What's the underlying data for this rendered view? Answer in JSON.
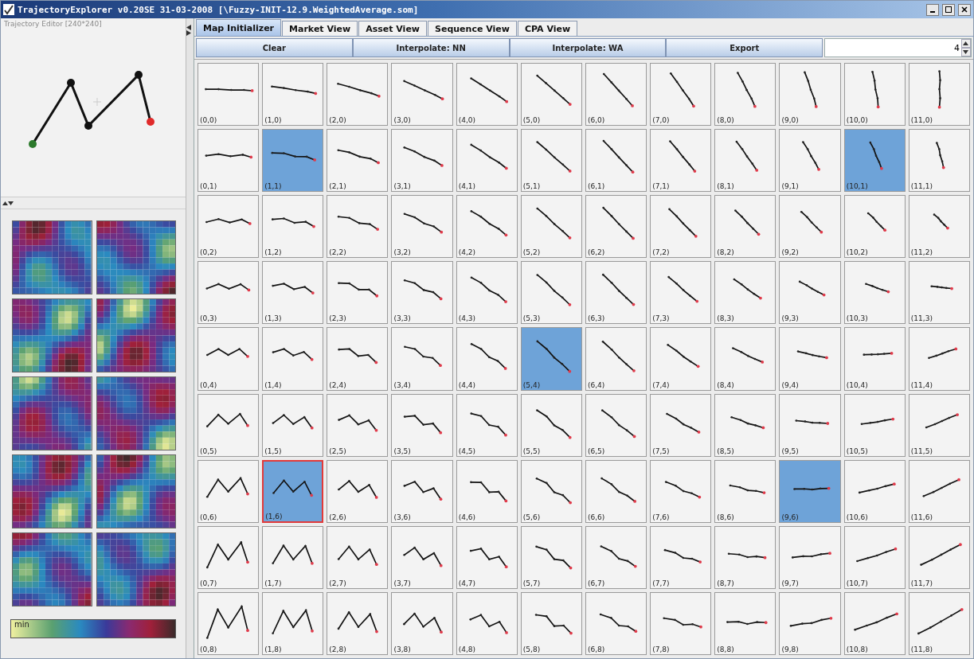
{
  "window": {
    "title": "TrajectoryExplorer v0.20SE 31-03-2008 [\\Fuzzy-INIT-12.9.WeightedAverage.som]"
  },
  "editor": {
    "title": "Trajectory Editor [240*240]"
  },
  "legend": {
    "label": "min"
  },
  "tabs": [
    {
      "label": "Map Initializer",
      "selected": true
    },
    {
      "label": "Market View",
      "selected": false
    },
    {
      "label": "Asset View",
      "selected": false
    },
    {
      "label": "Sequence View",
      "selected": false
    },
    {
      "label": "CPA View",
      "selected": false
    }
  ],
  "toolbar": {
    "buttons": [
      "Clear",
      "Interpolate: NN",
      "Interpolate: WA",
      "Export"
    ],
    "spinner": {
      "value": "4"
    }
  },
  "grid": {
    "rows": [
      [
        {
          "label": "(0,0)",
          "selected": false,
          "focused": false
        },
        {
          "label": "(1,0)",
          "selected": false,
          "focused": false
        },
        {
          "label": "(2,0)",
          "selected": false,
          "focused": false
        },
        {
          "label": "(3,0)",
          "selected": false,
          "focused": false
        },
        {
          "label": "(4,0)",
          "selected": false,
          "focused": false
        },
        {
          "label": "(5,0)",
          "selected": false,
          "focused": false
        },
        {
          "label": "(6,0)",
          "selected": false,
          "focused": false
        },
        {
          "label": "(7,0)",
          "selected": false,
          "focused": false
        },
        {
          "label": "(8,0)",
          "selected": false,
          "focused": false
        },
        {
          "label": "(9,0)",
          "selected": false,
          "focused": false
        },
        {
          "label": "(10,0)",
          "selected": false,
          "focused": false
        },
        {
          "label": "(11,0)",
          "selected": false,
          "focused": false
        }
      ],
      [
        {
          "label": "(0,1)",
          "selected": false,
          "focused": false
        },
        {
          "label": "(1,1)",
          "selected": true,
          "focused": false
        },
        {
          "label": "(2,1)",
          "selected": false,
          "focused": false
        },
        {
          "label": "(3,1)",
          "selected": false,
          "focused": false
        },
        {
          "label": "(4,1)",
          "selected": false,
          "focused": false
        },
        {
          "label": "(5,1)",
          "selected": false,
          "focused": false
        },
        {
          "label": "(6,1)",
          "selected": false,
          "focused": false
        },
        {
          "label": "(7,1)",
          "selected": false,
          "focused": false
        },
        {
          "label": "(8,1)",
          "selected": false,
          "focused": false
        },
        {
          "label": "(9,1)",
          "selected": false,
          "focused": false
        },
        {
          "label": "(10,1)",
          "selected": true,
          "focused": false
        },
        {
          "label": "(11,1)",
          "selected": false,
          "focused": false
        }
      ],
      [
        {
          "label": "(0,2)",
          "selected": false,
          "focused": false
        },
        {
          "label": "(1,2)",
          "selected": false,
          "focused": false
        },
        {
          "label": "(2,2)",
          "selected": false,
          "focused": false
        },
        {
          "label": "(3,2)",
          "selected": false,
          "focused": false
        },
        {
          "label": "(4,2)",
          "selected": false,
          "focused": false
        },
        {
          "label": "(5,2)",
          "selected": false,
          "focused": false
        },
        {
          "label": "(6,2)",
          "selected": false,
          "focused": false
        },
        {
          "label": "(7,2)",
          "selected": false,
          "focused": false
        },
        {
          "label": "(8,2)",
          "selected": false,
          "focused": false
        },
        {
          "label": "(9,2)",
          "selected": false,
          "focused": false
        },
        {
          "label": "(10,2)",
          "selected": false,
          "focused": false
        },
        {
          "label": "(11,2)",
          "selected": false,
          "focused": false
        }
      ],
      [
        {
          "label": "(0,3)",
          "selected": false,
          "focused": false
        },
        {
          "label": "(1,3)",
          "selected": false,
          "focused": false
        },
        {
          "label": "(2,3)",
          "selected": false,
          "focused": false
        },
        {
          "label": "(3,3)",
          "selected": false,
          "focused": false
        },
        {
          "label": "(4,3)",
          "selected": false,
          "focused": false
        },
        {
          "label": "(5,3)",
          "selected": false,
          "focused": false
        },
        {
          "label": "(6,3)",
          "selected": false,
          "focused": false
        },
        {
          "label": "(7,3)",
          "selected": false,
          "focused": false
        },
        {
          "label": "(8,3)",
          "selected": false,
          "focused": false
        },
        {
          "label": "(9,3)",
          "selected": false,
          "focused": false
        },
        {
          "label": "(10,3)",
          "selected": false,
          "focused": false
        },
        {
          "label": "(11,3)",
          "selected": false,
          "focused": false
        }
      ],
      [
        {
          "label": "(0,4)",
          "selected": false,
          "focused": false
        },
        {
          "label": "(1,4)",
          "selected": false,
          "focused": false
        },
        {
          "label": "(2,4)",
          "selected": false,
          "focused": false
        },
        {
          "label": "(3,4)",
          "selected": false,
          "focused": false
        },
        {
          "label": "(4,4)",
          "selected": false,
          "focused": false
        },
        {
          "label": "(5,4)",
          "selected": true,
          "focused": false
        },
        {
          "label": "(6,4)",
          "selected": false,
          "focused": false
        },
        {
          "label": "(7,4)",
          "selected": false,
          "focused": false
        },
        {
          "label": "(8,4)",
          "selected": false,
          "focused": false
        },
        {
          "label": "(9,4)",
          "selected": false,
          "focused": false
        },
        {
          "label": "(10,4)",
          "selected": false,
          "focused": false
        },
        {
          "label": "(11,4)",
          "selected": false,
          "focused": false
        }
      ],
      [
        {
          "label": "(0,5)",
          "selected": false,
          "focused": false
        },
        {
          "label": "(1,5)",
          "selected": false,
          "focused": false
        },
        {
          "label": "(2,5)",
          "selected": false,
          "focused": false
        },
        {
          "label": "(3,5)",
          "selected": false,
          "focused": false
        },
        {
          "label": "(4,5)",
          "selected": false,
          "focused": false
        },
        {
          "label": "(5,5)",
          "selected": false,
          "focused": false
        },
        {
          "label": "(6,5)",
          "selected": false,
          "focused": false
        },
        {
          "label": "(7,5)",
          "selected": false,
          "focused": false
        },
        {
          "label": "(8,5)",
          "selected": false,
          "focused": false
        },
        {
          "label": "(9,5)",
          "selected": false,
          "focused": false
        },
        {
          "label": "(10,5)",
          "selected": false,
          "focused": false
        },
        {
          "label": "(11,5)",
          "selected": false,
          "focused": false
        }
      ],
      [
        {
          "label": "(0,6)",
          "selected": false,
          "focused": false
        },
        {
          "label": "(1,6)",
          "selected": true,
          "focused": true
        },
        {
          "label": "(2,6)",
          "selected": false,
          "focused": false
        },
        {
          "label": "(3,6)",
          "selected": false,
          "focused": false
        },
        {
          "label": "(4,6)",
          "selected": false,
          "focused": false
        },
        {
          "label": "(5,6)",
          "selected": false,
          "focused": false
        },
        {
          "label": "(6,6)",
          "selected": false,
          "focused": false
        },
        {
          "label": "(7,6)",
          "selected": false,
          "focused": false
        },
        {
          "label": "(8,6)",
          "selected": false,
          "focused": false
        },
        {
          "label": "(9,6)",
          "selected": true,
          "focused": false
        },
        {
          "label": "(10,6)",
          "selected": false,
          "focused": false
        },
        {
          "label": "(11,6)",
          "selected": false,
          "focused": false
        }
      ],
      [
        {
          "label": "(0,7)",
          "selected": false,
          "focused": false
        },
        {
          "label": "(1,7)",
          "selected": false,
          "focused": false
        },
        {
          "label": "(2,7)",
          "selected": false,
          "focused": false
        },
        {
          "label": "(3,7)",
          "selected": false,
          "focused": false
        },
        {
          "label": "(4,7)",
          "selected": false,
          "focused": false
        },
        {
          "label": "(5,7)",
          "selected": false,
          "focused": false
        },
        {
          "label": "(6,7)",
          "selected": false,
          "focused": false
        },
        {
          "label": "(7,7)",
          "selected": false,
          "focused": false
        },
        {
          "label": "(8,7)",
          "selected": false,
          "focused": false
        },
        {
          "label": "(9,7)",
          "selected": false,
          "focused": false
        },
        {
          "label": "(10,7)",
          "selected": false,
          "focused": false
        },
        {
          "label": "(11,7)",
          "selected": false,
          "focused": false
        }
      ],
      [
        {
          "label": "(0,8)",
          "selected": false,
          "focused": false
        },
        {
          "label": "(1,8)",
          "selected": false,
          "focused": false
        },
        {
          "label": "(2,8)",
          "selected": false,
          "focused": false
        },
        {
          "label": "(3,8)",
          "selected": false,
          "focused": false
        },
        {
          "label": "(4,8)",
          "selected": false,
          "focused": false
        },
        {
          "label": "(5,8)",
          "selected": false,
          "focused": false
        },
        {
          "label": "(6,8)",
          "selected": false,
          "focused": false
        },
        {
          "label": "(7,8)",
          "selected": false,
          "focused": false
        },
        {
          "label": "(8,8)",
          "selected": false,
          "focused": false
        },
        {
          "label": "(9,8)",
          "selected": false,
          "focused": false
        },
        {
          "label": "(10,8)",
          "selected": false,
          "focused": false
        },
        {
          "label": "(11,8)",
          "selected": false,
          "focused": false
        }
      ]
    ]
  }
}
